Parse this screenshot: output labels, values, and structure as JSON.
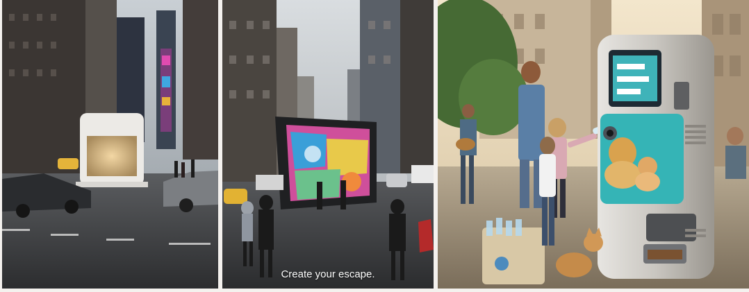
{
  "panels": [
    {
      "scene": "times-square-pod"
    },
    {
      "scene": "giant-tablet",
      "caption": "Create your escape."
    },
    {
      "scene": "recycling-kiosk"
    }
  ]
}
